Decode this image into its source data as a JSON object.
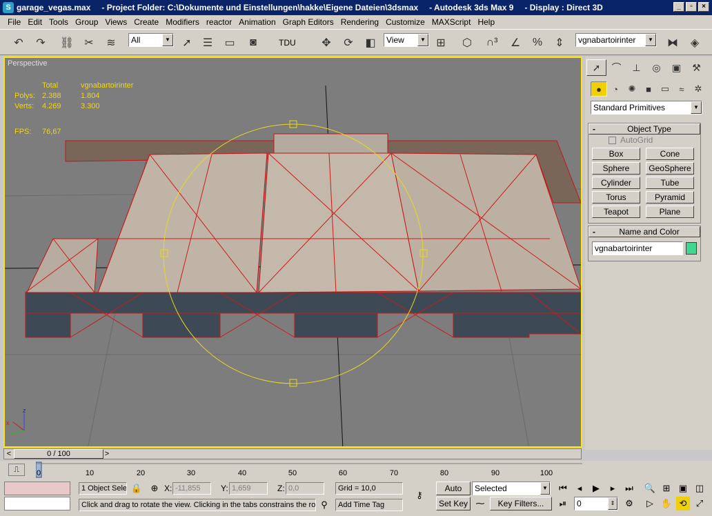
{
  "titlebar": {
    "filename": "garage_vegas.max",
    "project": "- Project Folder: C:\\Dokumente und Einstellungen\\hakke\\Eigene Dateien\\3dsmax",
    "app": "- Autodesk 3ds Max 9",
    "display": "- Display : Direct 3D",
    "icon": "3ds-max-logo"
  },
  "menu": [
    "File",
    "Edit",
    "Tools",
    "Group",
    "Views",
    "Create",
    "Modifiers",
    "reactor",
    "Animation",
    "Graph Editors",
    "Rendering",
    "Customize",
    "MAXScript",
    "Help"
  ],
  "toolbar": {
    "selection_filter": "All",
    "tdu_label": "TDU",
    "ref_coord": "View",
    "named_selection": "vgnabartoirinter",
    "icons": [
      "undo-icon",
      "redo-icon",
      "select-link-icon",
      "unlink-icon",
      "bind-space-warp-icon",
      "select-object-icon",
      "select-by-name-icon",
      "rect-region-icon",
      "window-crossing-icon",
      "move-icon",
      "rotate-icon",
      "scale-icon",
      "pivot-icon",
      "snap-3-icon",
      "angle-snap-icon",
      "percent-snap-icon",
      "spinner-snap-icon",
      "mirror-icon",
      "align-icon"
    ]
  },
  "viewport": {
    "label": "Perspective",
    "stats": {
      "header": [
        "",
        "Total",
        "vgnabartoirinter"
      ],
      "rows": [
        [
          "Polys:",
          "2.388",
          "1.804"
        ],
        [
          "Verts:",
          "4.269",
          "3.300"
        ]
      ],
      "fps_label": "FPS:",
      "fps_value": "76,67"
    },
    "axis_z": "z",
    "axis_x": "x",
    "bg_color": "#7d7d7d",
    "selection_color": "#ffe600"
  },
  "cmdpanel": {
    "tabs": [
      "create-tab-icon",
      "modify-tab-icon",
      "hierarchy-tab-icon",
      "motion-tab-icon",
      "display-tab-icon",
      "utilities-tab-icon"
    ],
    "subcats": [
      "geometry-icon",
      "shapes-icon",
      "lights-icon",
      "cameras-icon",
      "helpers-icon",
      "spacewarps-icon",
      "systems-icon"
    ],
    "primitive_type": "Standard Primitives",
    "object_type_title": "Object Type",
    "autogrid": "AutoGrid",
    "buttons": [
      "Box",
      "Cone",
      "Sphere",
      "GeoSphere",
      "Cylinder",
      "Tube",
      "Torus",
      "Pyramid",
      "Teapot",
      "Plane"
    ],
    "name_color_title": "Name and Color",
    "object_name": "vgnabartoirinter",
    "object_color": "#40d890"
  },
  "timeslider": {
    "frame": "0 / 100",
    "left_arrow": "<",
    "right_arrow": ">"
  },
  "trackbar": {
    "ticks": [
      "0",
      "10",
      "20",
      "30",
      "40",
      "50",
      "60",
      "70",
      "80",
      "90",
      "100"
    ]
  },
  "status": {
    "selection_count": "1 Object Sele",
    "x_label": "X:",
    "x_value": "-11,855",
    "y_label": "Y:",
    "y_value": "1,659",
    "z_label": "Z:",
    "z_value": "0,0",
    "grid": "Grid = 10,0",
    "prompt": "Click and drag to rotate the view.  Clicking in the tabs constrains the rota",
    "add_time_tag": "Add Time Tag",
    "auto_key": "Auto Key",
    "set_key": "Set Key",
    "key_mode": "Selected",
    "key_filters": "Key Filters...",
    "current_frame": "0"
  }
}
